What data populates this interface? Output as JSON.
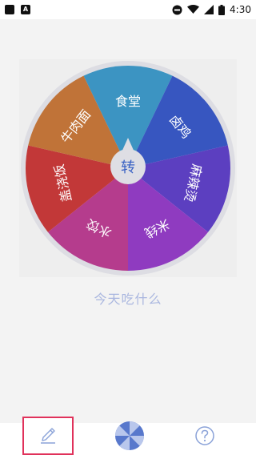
{
  "status_bar": {
    "time": "4:30",
    "left_icons": [
      "square-notification-icon",
      "a-notification-icon"
    ],
    "right_icons": [
      "do-not-disturb-icon",
      "wifi-icon",
      "signal-icon",
      "battery-icon"
    ]
  },
  "wheel": {
    "center_label": "转",
    "segments": [
      {
        "label": "食堂",
        "color": "#3c94c2"
      },
      {
        "label": "卤鸡",
        "color": "#3756c0"
      },
      {
        "label": "麻辣烫",
        "color": "#5c3fc0"
      },
      {
        "label": "米线",
        "color": "#8f3bc0"
      },
      {
        "label": "水饺",
        "color": "#b53c8d"
      },
      {
        "label": "盖浇饭",
        "color": "#c23838"
      },
      {
        "label": "牛肉面",
        "color": "#c07338"
      }
    ]
  },
  "tagline": "今天吃什么",
  "bottom_nav": {
    "items": [
      {
        "name": "edit",
        "icon": "pencil-icon"
      },
      {
        "name": "spin",
        "icon": "pinwheel-icon"
      },
      {
        "name": "help",
        "icon": "help-circle-icon"
      }
    ]
  }
}
